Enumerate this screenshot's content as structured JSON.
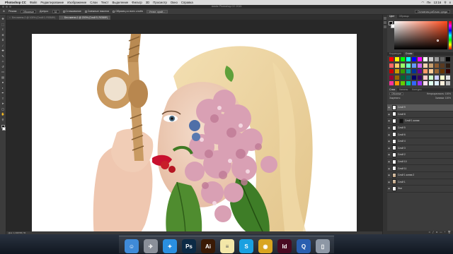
{
  "menubar": {
    "app_name": "Photoshop CC",
    "menus": [
      "Файл",
      "Редактирование",
      "Изображение",
      "Слои",
      "Текст",
      "Выделение",
      "Фильтр",
      "3D",
      "Просмотр",
      "Окно",
      "Справка"
    ],
    "time": "13:16",
    "day": "Пн"
  },
  "window": {
    "title": "Adobe Photoshop CC 2015"
  },
  "options": {
    "mode_label": "Режим:",
    "mode_value": "Обычные",
    "tolerance_label": "Допуск:",
    "tolerance_value": "32",
    "antialias_label": "Сглаживание",
    "contiguous_label": "Смежные пиксели",
    "sample_all_label": "Образец со всех слоёв",
    "refine_button": "Уточн. край...",
    "workspace": "Основная рабочая среда"
  },
  "doc_tabs": [
    {
      "label": "Без имени-2 @ 100% (Слой 0, RGB/8*)",
      "active": false
    },
    {
      "label": "Без имени-1 @ 200% (Слой 9, RGB/8*)",
      "active": true
    }
  ],
  "status": {
    "text": "Док: 1,30М/58,7М"
  },
  "panels": {
    "color_tabs": [
      "Цвет",
      "Образцы"
    ],
    "swatch_tabs": [
      "Коррекция",
      "Стили"
    ],
    "layers_tabs": [
      "Слои",
      "Каналы",
      "Контуры"
    ],
    "blend_mode": "Обычные",
    "opacity_label": "Непрозрачность:",
    "opacity_value": "100%",
    "lock_label": "Закрепить:",
    "fill_label": "Заливка:",
    "fill_value": "100%",
    "accent_color": "#ff4a1a"
  },
  "layers": [
    {
      "name": "Слой 9",
      "active": true,
      "thumb": "plain"
    },
    {
      "name": "Слой 8",
      "active": false,
      "thumb": "plain"
    },
    {
      "name": "Слой 1 копия",
      "active": false,
      "thumb": "mask"
    },
    {
      "name": "Слой 5",
      "active": false,
      "thumb": "plain"
    },
    {
      "name": "Слой 6",
      "active": false,
      "thumb": "plain"
    },
    {
      "name": "Слой 4",
      "active": false,
      "thumb": "plain"
    },
    {
      "name": "Слой 3",
      "active": false,
      "thumb": "plain"
    },
    {
      "name": "Слой 2",
      "active": false,
      "thumb": "plain"
    },
    {
      "name": "Слой 10",
      "active": false,
      "thumb": "plain"
    },
    {
      "name": "Слой 11",
      "active": false,
      "thumb": "plain"
    },
    {
      "name": "Слой 1 копия 2",
      "active": false,
      "thumb": "pic"
    },
    {
      "name": "Слой 1",
      "active": false,
      "thumb": "pic"
    },
    {
      "name": "Фон",
      "active": false,
      "thumb": "plain"
    }
  ],
  "swatch_colors": [
    "#ff0000",
    "#ffff00",
    "#00ff00",
    "#00ffff",
    "#0000ff",
    "#ff00ff",
    "#ffffff",
    "#cccccc",
    "#999999",
    "#666666",
    "#000000",
    "#ff6666",
    "#ffcc66",
    "#99ff66",
    "#66ffcc",
    "#6699ff",
    "#cc66ff",
    "#f2d0b0",
    "#c8a070",
    "#8a5a30",
    "#5a3a20",
    "#2a1a10",
    "#cc0000",
    "#cc9900",
    "#339900",
    "#009999",
    "#003399",
    "#660099",
    "#ff9966",
    "#ffcc99",
    "#996633",
    "#663300",
    "#330000",
    "#990033",
    "#996600",
    "#006633",
    "#006666",
    "#000066",
    "#330066",
    "#ffcccc",
    "#ccffcc",
    "#ccccff",
    "#ffffcc",
    "#e0e0e0",
    "#ff3399",
    "#ff9900",
    "#66cc00",
    "#00cc99",
    "#3366ff",
    "#9933ff",
    "#ffddee",
    "#ddffee",
    "#ddeeff",
    "#fff0dd",
    "#bbbbbb"
  ],
  "dock_apps": [
    {
      "name": "finder",
      "glyph": "☺",
      "color": "#3f8ad8"
    },
    {
      "name": "launchpad",
      "glyph": "✈",
      "color": "#8a8f99"
    },
    {
      "name": "safari",
      "glyph": "✦",
      "color": "#2a8fe0"
    },
    {
      "name": "photoshop",
      "glyph": "Ps",
      "color": "#0c2a45"
    },
    {
      "name": "illustrator",
      "glyph": "Ai",
      "color": "#3a1a05"
    },
    {
      "name": "notes",
      "glyph": "≡",
      "color": "#f3e7a8"
    },
    {
      "name": "skype",
      "glyph": "S",
      "color": "#1aa0e0"
    },
    {
      "name": "chrome",
      "glyph": "◉",
      "color": "#d9a520"
    },
    {
      "name": "indesign",
      "glyph": "Id",
      "color": "#4a0a22"
    },
    {
      "name": "quicktime",
      "glyph": "Q",
      "color": "#2a5fb0"
    },
    {
      "name": "trash",
      "glyph": "▯",
      "color": "#8d97a5"
    }
  ]
}
